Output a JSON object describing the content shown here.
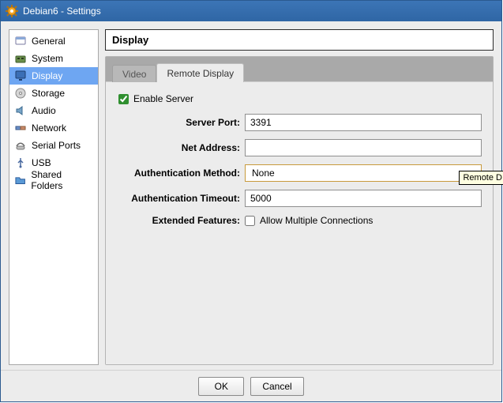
{
  "window": {
    "title": "Debian6 - Settings"
  },
  "sidebar": {
    "items": [
      {
        "label": "General"
      },
      {
        "label": "System"
      },
      {
        "label": "Display"
      },
      {
        "label": "Storage"
      },
      {
        "label": "Audio"
      },
      {
        "label": "Network"
      },
      {
        "label": "Serial Ports"
      },
      {
        "label": "USB"
      },
      {
        "label": "Shared Folders"
      }
    ],
    "selected_index": 2
  },
  "panel": {
    "title": "Display",
    "tabs": [
      {
        "label": "Video"
      },
      {
        "label": "Remote Display"
      }
    ],
    "active_tab_index": 1
  },
  "remote_display": {
    "enable_label": "Enable Server",
    "enable_checked": true,
    "server_port_label": "Server Port:",
    "server_port_value": "3391",
    "net_address_label": "Net Address:",
    "net_address_value": "",
    "auth_method_label": "Authentication Method:",
    "auth_method_value": "None",
    "auth_timeout_label": "Authentication Timeout:",
    "auth_timeout_value": "5000",
    "extended_features_label": "Extended Features:",
    "allow_multi_label": "Allow Multiple Connections",
    "allow_multi_checked": false
  },
  "buttons": {
    "ok": "OK",
    "cancel": "Cancel"
  },
  "tooltip_fragment": "Remote D"
}
